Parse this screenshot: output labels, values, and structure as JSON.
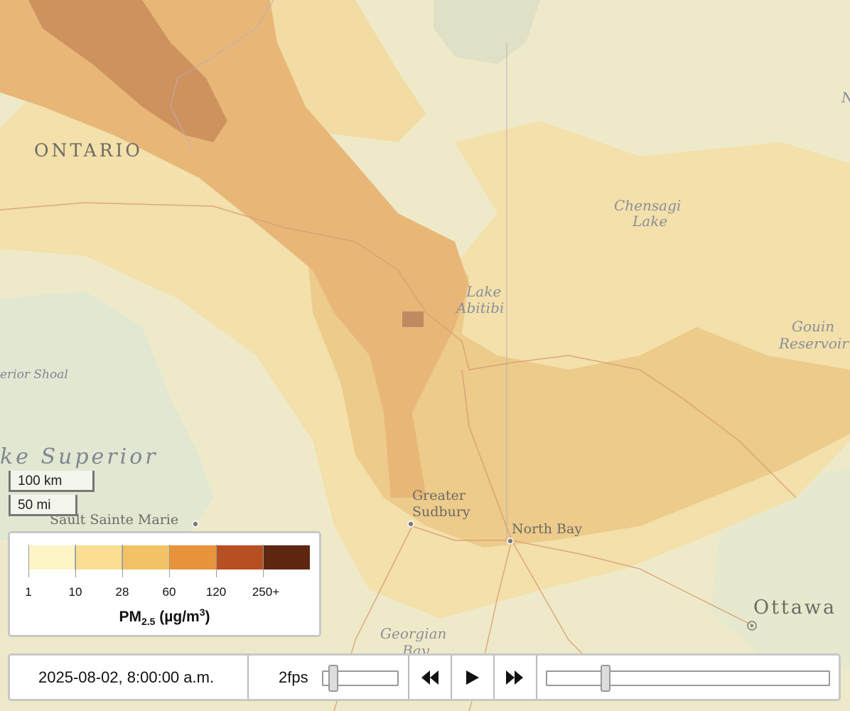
{
  "map_labels": {
    "ontario": "ONTARIO",
    "chensagi": "Chensagi",
    "chensagi_line2": "Lake",
    "lake_abitibi": "Lake",
    "lake_abitibi_line2": "Abitibi",
    "gouin": "Gouin",
    "gouin_line2": "Reservoir",
    "superior_shoal": "erior Shoal",
    "lake_superior": "ke Superior",
    "sault": "Sault Sainte Marie",
    "sudbury": "Greater",
    "sudbury_line2": "Sudbury",
    "north_bay": "North Bay",
    "ottawa": "Ottawa",
    "georgian": "Georgian",
    "georgian_line2": "Bay",
    "edge_letter": "N"
  },
  "scale": {
    "km": "100 km",
    "mi": "50 mi"
  },
  "legend": {
    "title_main": "PM",
    "title_sub": "2.5",
    "title_unit_prefix": " (µg/m",
    "title_unit_sup": "3",
    "title_unit_suffix": ")",
    "ticks": [
      "1",
      "10",
      "28",
      "60",
      "120",
      "250+"
    ],
    "colors": [
      "#fef5c6",
      "#f9de94",
      "#f3c267",
      "#e8943d",
      "#b84f22",
      "#5f2712"
    ]
  },
  "controls": {
    "timestamp": "2025-08-02, 8:00:00 a.m.",
    "fps": "2fps",
    "fps_slider_value": 0.1,
    "time_slider_value": 0.2
  },
  "icons": {
    "rewind": "double-left-triangle",
    "play": "right-triangle",
    "fast_forward": "double-right-triangle"
  }
}
